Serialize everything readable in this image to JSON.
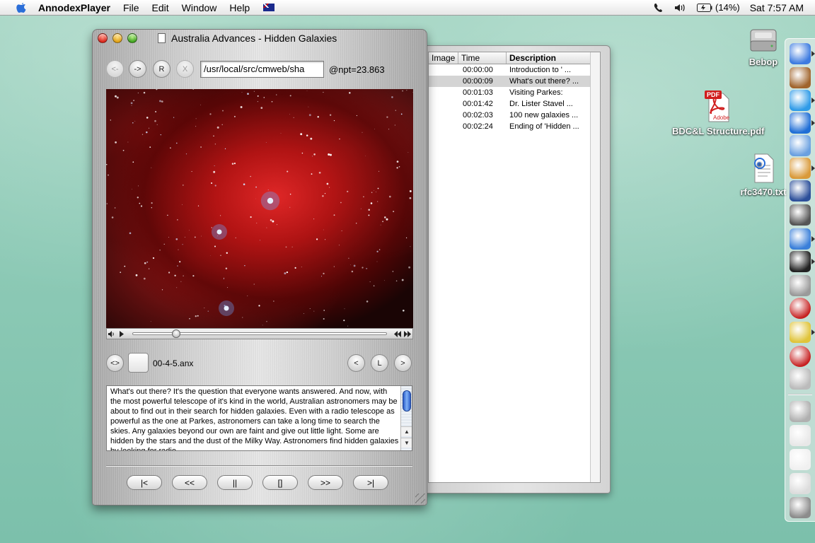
{
  "menubar": {
    "app_name": "AnnodexPlayer",
    "menus": [
      "File",
      "Edit",
      "Window",
      "Help"
    ],
    "battery": "(14%)",
    "clock": "Sat 7:57 AM"
  },
  "player": {
    "title": "Australia Advances - Hidden Galaxies",
    "nav": {
      "back": "<-",
      "forward": "->",
      "reload": "R",
      "stop": "X"
    },
    "url": "/usr/local/src/cmweb/sha",
    "npt": "@npt=23.863",
    "filename": "00-4-5.anx",
    "clip_nav": {
      "toggle": "<>",
      "prev": "<",
      "list": "L",
      "next": ">"
    },
    "description": "What's out there? It's the question that everyone wants answered. And now, with the most powerful telescope of it's kind in the world, Australian astronomers may be about to find out in their search for hidden galaxies. Even with a radio telescope as powerful as the one at Parkes, astronomers can take a long time to search the skies. Any galaxies beyond our own are faint and give out little light. Some are hidden by the stars and the dust of the Milky Way. Astronomers find hidden galaxies by looking for radio",
    "transport": [
      {
        "name": "go-to-start-button",
        "label": "|<"
      },
      {
        "name": "rewind-button",
        "label": "<<"
      },
      {
        "name": "pause-button",
        "label": "||"
      },
      {
        "name": "stop-button",
        "label": "[]"
      },
      {
        "name": "fast-forward-button",
        "label": ">>"
      },
      {
        "name": "go-to-end-button",
        "label": ">|"
      }
    ],
    "playback_position": 0.17
  },
  "clip_list": {
    "headers": {
      "image": "Image",
      "time": "Time",
      "description": "Description"
    },
    "rows": [
      {
        "time": "00:00:00",
        "description": "Introduction to ' ...",
        "selected": false
      },
      {
        "time": "00:00:09",
        "description": "What's out there? ...",
        "selected": true
      },
      {
        "time": "00:01:03",
        "description": "Visiting Parkes:",
        "selected": false
      },
      {
        "time": "00:01:42",
        "description": "Dr. Lister Stavel ...",
        "selected": false
      },
      {
        "time": "00:02:03",
        "description": "100 new galaxies  ...",
        "selected": false
      },
      {
        "time": "00:02:24",
        "description": "Ending of 'Hidden ...",
        "selected": false
      }
    ]
  },
  "desktop": {
    "icons": [
      {
        "label": "Bebop",
        "icon": "hard-drive-icon"
      },
      {
        "label": "BDC&L Structure.pdf",
        "icon": "pdf-document-icon",
        "badge": "PDF",
        "sub": "Adobe"
      },
      {
        "label": "rfc3470.txt",
        "icon": "text-document-icon"
      }
    ]
  },
  "dock": {
    "items": [
      "finder-icon",
      "hammer-icon",
      "ichat-icon",
      "internet-explorer-icon",
      "itunes-icon",
      "iphoto-icon",
      "imovie-icon",
      "sherlock-icon",
      "quicktime-icon",
      "terminal-icon",
      "system-preferences-icon",
      "annodex-icon",
      "web-icon",
      "annodex-icon-2",
      "utility-icon",
      "mail-icon",
      "document-icon",
      "window-icon",
      "file-icon",
      "trash-icon"
    ]
  },
  "colors": {
    "desktop": "#8fcbb7",
    "selection": "#d4d4d4",
    "scroll_knob": "#2c5dc9"
  }
}
